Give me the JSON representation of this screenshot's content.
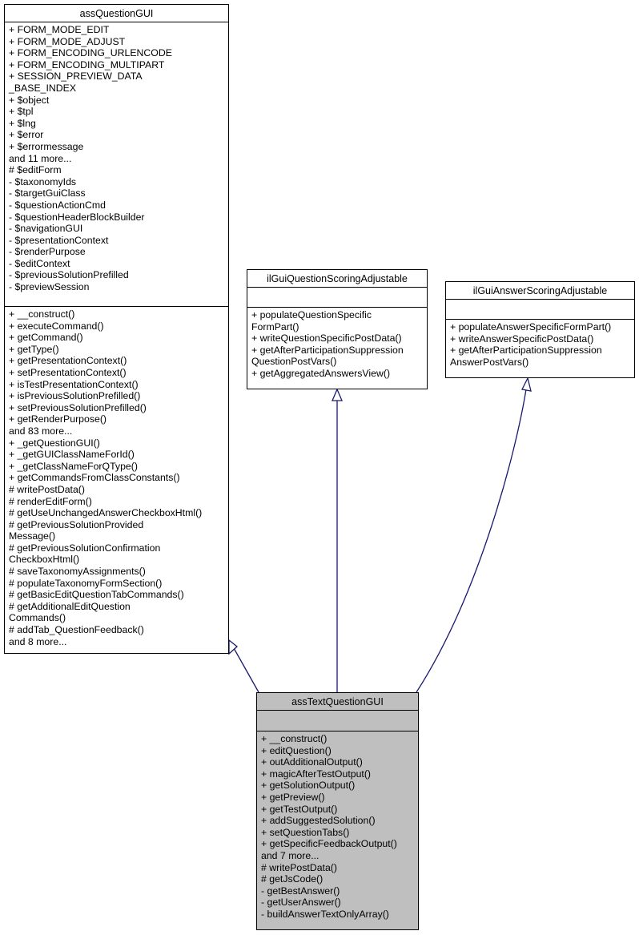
{
  "diagram": {
    "type": "uml-class-inheritance",
    "edge_color": "#191970",
    "classes": {
      "assQuestionGUI": {
        "name": "assQuestionGUI",
        "attributes": [
          "+ FORM_MODE_EDIT",
          "+ FORM_MODE_ADJUST",
          "+ FORM_ENCODING_URLENCODE",
          "+ FORM_ENCODING_MULTIPART",
          "+ SESSION_PREVIEW_DATA",
          "_BASE_INDEX",
          "+ $object",
          "+ $tpl",
          "+ $lng",
          "+ $error",
          "+ $errormessage",
          "and 11 more...",
          "# $editForm",
          "- $taxonomyIds",
          "- $targetGuiClass",
          "- $questionActionCmd",
          "- $questionHeaderBlockBuilder",
          "- $navigationGUI",
          "- $presentationContext",
          "- $renderPurpose",
          "- $editContext",
          "- $previousSolutionPrefilled",
          "- $previewSession"
        ],
        "methods": [
          "+ __construct()",
          "+ executeCommand()",
          "+ getCommand()",
          "+ getType()",
          "+ getPresentationContext()",
          "+ setPresentationContext()",
          "+ isTestPresentationContext()",
          "+ isPreviousSolutionPrefilled()",
          "+ setPreviousSolutionPrefilled()",
          "+ getRenderPurpose()",
          "and 83 more...",
          "+ _getQuestionGUI()",
          "+ _getGUIClassNameForId()",
          "+ _getClassNameForQType()",
          "+ getCommandsFromClassConstants()",
          "# writePostData()",
          "# renderEditForm()",
          "# getUseUnchangedAnswerCheckboxHtml()",
          "# getPreviousSolutionProvided",
          "Message()",
          "# getPreviousSolutionConfirmation",
          "CheckboxHtml()",
          "# saveTaxonomyAssignments()",
          "# populateTaxonomyFormSection()",
          "# getBasicEditQuestionTabCommands()",
          "# getAdditionalEditQuestion",
          "Commands()",
          "# addTab_QuestionFeedback()",
          "and 8 more..."
        ]
      },
      "ilGuiQuestionScoringAdjustable": {
        "name": "ilGuiQuestionScoringAdjustable",
        "attributes": [],
        "methods": [
          "+ populateQuestionSpecific",
          "FormPart()",
          "+ writeQuestionSpecificPostData()",
          "+ getAfterParticipationSuppression",
          "QuestionPostVars()",
          "+ getAggregatedAnswersView()"
        ]
      },
      "ilGuiAnswerScoringAdjustable": {
        "name": "ilGuiAnswerScoringAdjustable",
        "attributes": [],
        "methods": [
          "+ populateAnswerSpecificFormPart()",
          "+ writeAnswerSpecificPostData()",
          "+ getAfterParticipationSuppression",
          "AnswerPostVars()"
        ]
      },
      "assTextQuestionGUI": {
        "name": "assTextQuestionGUI",
        "attributes": [],
        "methods": [
          "+ __construct()",
          "+ editQuestion()",
          "+ outAdditionalOutput()",
          "+ magicAfterTestOutput()",
          "+ getSolutionOutput()",
          "+ getPreview()",
          "+ getTestOutput()",
          "+ addSuggestedSolution()",
          "+ setQuestionTabs()",
          "+ getSpecificFeedbackOutput()",
          "and 7 more...",
          "# writePostData()",
          "# getJsCode()",
          "- getBestAnswer()",
          "- getUserAnswer()",
          "- buildAnswerTextOnlyArray()"
        ]
      }
    },
    "edges": [
      {
        "from": "assTextQuestionGUI",
        "to": "assQuestionGUI",
        "kind": "inheritance"
      },
      {
        "from": "assTextQuestionGUI",
        "to": "ilGuiQuestionScoringAdjustable",
        "kind": "inheritance"
      },
      {
        "from": "assTextQuestionGUI",
        "to": "ilGuiAnswerScoringAdjustable",
        "kind": "inheritance"
      }
    ]
  }
}
